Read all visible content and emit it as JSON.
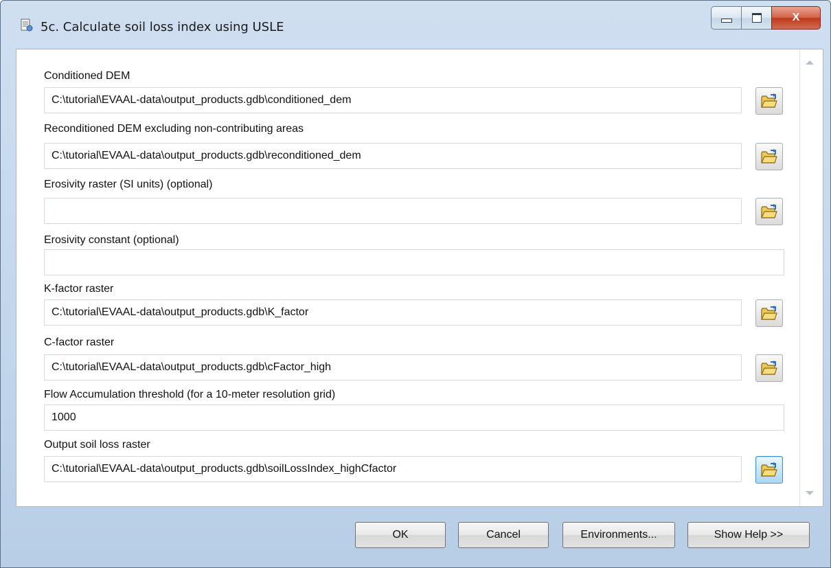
{
  "window": {
    "title": "5c. Calculate soil loss index using USLE"
  },
  "caption_buttons": {
    "close_glyph": "X"
  },
  "fields": [
    {
      "label": "Conditioned DEM",
      "value": "C:\\tutorial\\EVAAL-data\\output_products.gdb\\conditioned_dem",
      "has_browse": true
    },
    {
      "label": "Reconditioned DEM excluding non-contributing areas",
      "value": "C:\\tutorial\\EVAAL-data\\output_products.gdb\\reconditioned_dem",
      "has_browse": true
    },
    {
      "label": "Erosivity raster (SI units) (optional)",
      "value": "",
      "has_browse": true
    },
    {
      "label": "Erosivity constant (optional)",
      "value": "",
      "has_browse": false
    },
    {
      "label": "K-factor raster",
      "value": "C:\\tutorial\\EVAAL-data\\output_products.gdb\\K_factor",
      "has_browse": true
    },
    {
      "label": "C-factor raster",
      "value": "C:\\tutorial\\EVAAL-data\\output_products.gdb\\cFactor_high",
      "has_browse": true
    },
    {
      "label": "Flow Accumulation threshold (for a 10-meter resolution grid)",
      "value": "1000",
      "has_browse": false
    },
    {
      "label": "Output soil loss raster",
      "value": "C:\\tutorial\\EVAAL-data\\output_products.gdb\\soilLossIndex_highCfactor",
      "has_browse": true
    }
  ],
  "icons": {
    "title": "toolbox-script-icon",
    "browse": "open-folder-icon"
  },
  "buttons": {
    "ok": "OK",
    "cancel": "Cancel",
    "environments": "Environments...",
    "show_help": "Show Help >>"
  },
  "colors": {
    "frame": "#c2d6ec",
    "close_button": "#c0381b",
    "active_browse": "#3c8fd1"
  }
}
